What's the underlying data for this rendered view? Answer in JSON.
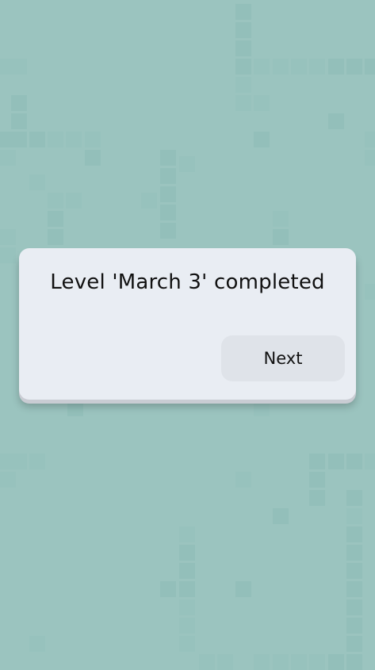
{
  "dialog": {
    "message": "Level 'March 3' completed",
    "next_label": "Next"
  },
  "colors": {
    "background": "#9bc4bf",
    "tile": "#8cbab5",
    "dialog": "#e9edf3",
    "button": "#dfe3e9"
  }
}
